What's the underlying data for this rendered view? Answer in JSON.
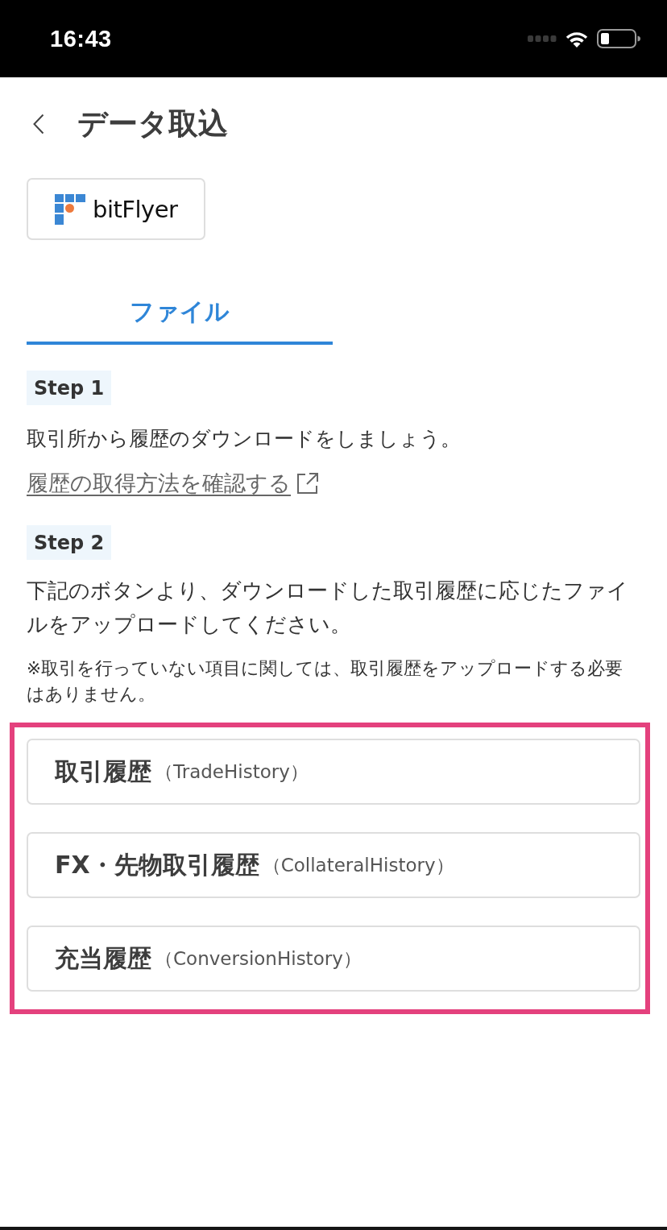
{
  "status_bar": {
    "time": "16:43"
  },
  "header": {
    "title": "データ取込"
  },
  "exchange": {
    "name": "bitFlyer"
  },
  "tabs": [
    {
      "label": "ファイル",
      "selected": true
    }
  ],
  "steps": [
    {
      "label": "Step 1",
      "texts": [
        {
          "kind": "text",
          "text": "取引所から履歴のダウンロードをしましょう。"
        },
        {
          "kind": "link",
          "text": "履歴の取得方法を確認する"
        }
      ]
    },
    {
      "label": "Step 2",
      "texts": [
        {
          "kind": "text",
          "text": "下記のボタンより、ダウンロードした取引履歴に応じたファイルをアップロードしてください。"
        },
        {
          "kind": "note",
          "text": "※取引を行っていない項目に関しては、取引履歴をアップロードする必要はありません。"
        }
      ]
    }
  ],
  "history_buttons": {
    "highlighted": true,
    "items": [
      {
        "title": "取引履歴",
        "subtitle": "（TradeHistory）"
      },
      {
        "title": "FX・先物取引履歴",
        "subtitle": "（CollateralHistory）"
      },
      {
        "title": "充当履歴",
        "subtitle": "（ConversionHistory）"
      }
    ]
  }
}
